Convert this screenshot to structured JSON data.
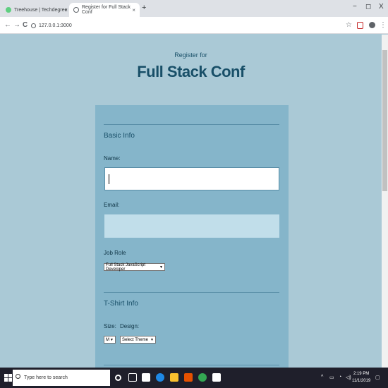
{
  "browser": {
    "tabs": [
      {
        "label": "Treehouse | Techdegree",
        "active": false
      },
      {
        "label": "Register for Full Stack Conf",
        "active": true
      }
    ],
    "new_tab": "+",
    "window_controls": {
      "minimize": "−",
      "restore": "◻",
      "close": "X"
    },
    "nav": {
      "back": "←",
      "forward": "→",
      "reload": "C"
    },
    "url": "127.0.0.1:3000",
    "tab_close": "×"
  },
  "page": {
    "pre_title": "Register for",
    "title": "Full Stack Conf",
    "basic_info": {
      "legend": "Basic Info",
      "name_label": "Name:",
      "name_value": "",
      "email_label": "Email:",
      "email_value": "",
      "job_role_label": "Job Role",
      "job_role_selected": "Full Stack JavaScript Developer"
    },
    "tshirt_info": {
      "legend": "T-Shirt Info",
      "size_label": "Size:",
      "size_selected": "M",
      "design_label": "Design:",
      "design_selected": "Select Theme"
    }
  },
  "taskbar": {
    "search_placeholder": "Type here to search",
    "time": "2:19 PM",
    "date": "11/1/2019"
  },
  "colors": {
    "title": "#184f68",
    "page_bg": "#aac9d6",
    "form_bg": "#85b5ca",
    "email_field": "#c1deea"
  }
}
